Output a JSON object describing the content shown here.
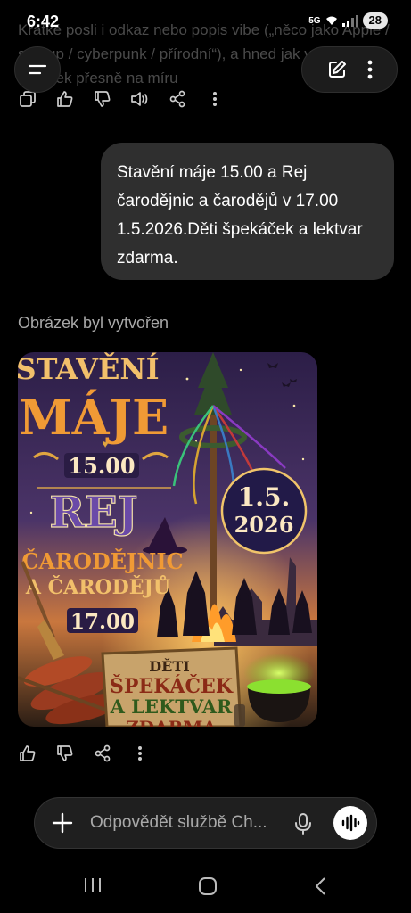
{
  "status_bar": {
    "time": "6:42",
    "network": "5G",
    "battery": "28"
  },
  "previous_message": {
    "text": "Krátké posli i odkaz nebo popis vibe („něco jako Apple / startup / cyberpunk / přírodní“), a hned jak vytvořím obrázek přesně na míru"
  },
  "header": {
    "menu_icon": "menu-icon",
    "new_chat_icon": "edit-icon",
    "more_icon": "more-vertical-icon"
  },
  "top_actions": [
    "copy-icon",
    "thumbs-up-icon",
    "thumbs-down-icon",
    "speaker-icon",
    "share-icon",
    "more-vertical-icon"
  ],
  "user_message": {
    "text": "Stavění máje 15.00 a Rej čarodějnic a čarodějů v 17.00 1.5.2026.Děti špekáček a lektvar zdarma."
  },
  "assistant": {
    "status": "Obrázek byl vytvořen"
  },
  "poster": {
    "title_line1": "STAVĚNÍ",
    "title_line2": "MÁJE",
    "time1": "15.00",
    "rej": "REJ",
    "line_carodejnic": "ČARODĚJNIC",
    "line_carodeju": "A ČARODĚJŮ",
    "time2": "17.00",
    "date_line1": "1.5.",
    "date_line2": "2026",
    "sign_line1": "DĚTI",
    "sign_line2": "ŠPEKÁČEK",
    "sign_line3": "A LEKTVAR",
    "sign_line4": "ZDARMA"
  },
  "bottom_actions": [
    "thumbs-up-icon",
    "thumbs-down-icon",
    "share-icon",
    "more-vertical-icon"
  ],
  "composer": {
    "placeholder": "Odpovědět službě Ch...",
    "plus_icon": "plus-icon",
    "mic_icon": "mic-icon",
    "voice_icon": "voice-mode-icon"
  },
  "nav_bar": [
    "recents-icon",
    "home-icon",
    "back-icon"
  ],
  "colors": {
    "background": "#000000",
    "bubble": "#2f2f2f",
    "poster_orange": "#f0a33a",
    "poster_purple": "#3a2658"
  }
}
